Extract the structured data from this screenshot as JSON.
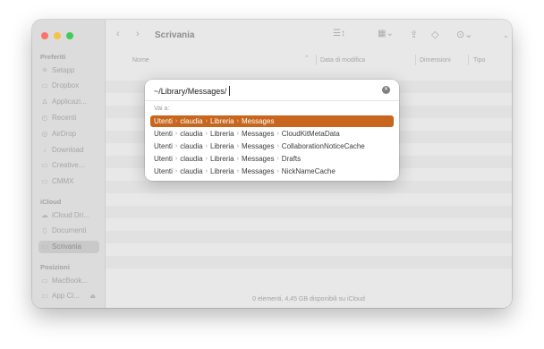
{
  "window": {
    "title": "Scrivania",
    "status": "0 elementi, 4,45 GB disponibili su iCloud"
  },
  "traffic_lights": [
    "#ff5f57",
    "#febc2e",
    "#28c840"
  ],
  "toolbar": {
    "back_icon": "chevron-left-icon",
    "forward_icon": "chevron-right-icon",
    "view_icon": "list-view-icon",
    "group_icon": "grid-view-icon",
    "share_icon": "share-icon",
    "tag_icon": "tag-icon",
    "more_icon": "ellipsis-circle-icon",
    "search_icon": "search-icon"
  },
  "columns": {
    "name": "Nome",
    "modified": "Data di modifica",
    "size": "Dimensioni",
    "kind": "Tipo"
  },
  "sidebar": {
    "favorites_heading": "Preferiti",
    "favorites": [
      {
        "label": "Setapp",
        "icon": "setapp-icon"
      },
      {
        "label": "Dropbox",
        "icon": "folder-icon"
      },
      {
        "label": "Applicazi...",
        "icon": "applications-icon"
      },
      {
        "label": "Recenti",
        "icon": "clock-icon"
      },
      {
        "label": "AirDrop",
        "icon": "airdrop-icon"
      },
      {
        "label": "Download",
        "icon": "download-icon"
      },
      {
        "label": "Creative...",
        "icon": "folder-icon"
      },
      {
        "label": "CMMX",
        "icon": "folder-icon"
      }
    ],
    "icloud_heading": "iCloud",
    "icloud": [
      {
        "label": "iCloud Dri...",
        "icon": "cloud-icon"
      },
      {
        "label": "Documenti",
        "icon": "document-icon"
      },
      {
        "label": "Scrivania",
        "icon": "desktop-icon",
        "selected": true
      }
    ],
    "locations_heading": "Posizioni",
    "locations": [
      {
        "label": "MacBook...",
        "icon": "laptop-icon"
      },
      {
        "label": "App Cl...",
        "icon": "drive-icon"
      }
    ]
  },
  "goto_dialog": {
    "path_value": "~/Library/Messages/",
    "goto_label": "Vai a:",
    "accent": "#c7661c",
    "suggestions": [
      {
        "parts": [
          "Utenti",
          "claudia",
          "Libreria",
          "Messages"
        ],
        "selected": true
      },
      {
        "parts": [
          "Utenti",
          "claudia",
          "Libreria",
          "Messages",
          "CloudKitMetaData"
        ]
      },
      {
        "parts": [
          "Utenti",
          "claudia",
          "Libreria",
          "Messages",
          "CollaborationNoticeCache"
        ]
      },
      {
        "parts": [
          "Utenti",
          "claudia",
          "Libreria",
          "Messages",
          "Drafts"
        ]
      },
      {
        "parts": [
          "Utenti",
          "claudia",
          "Libreria",
          "Messages",
          "NickNameCache"
        ]
      }
    ]
  }
}
